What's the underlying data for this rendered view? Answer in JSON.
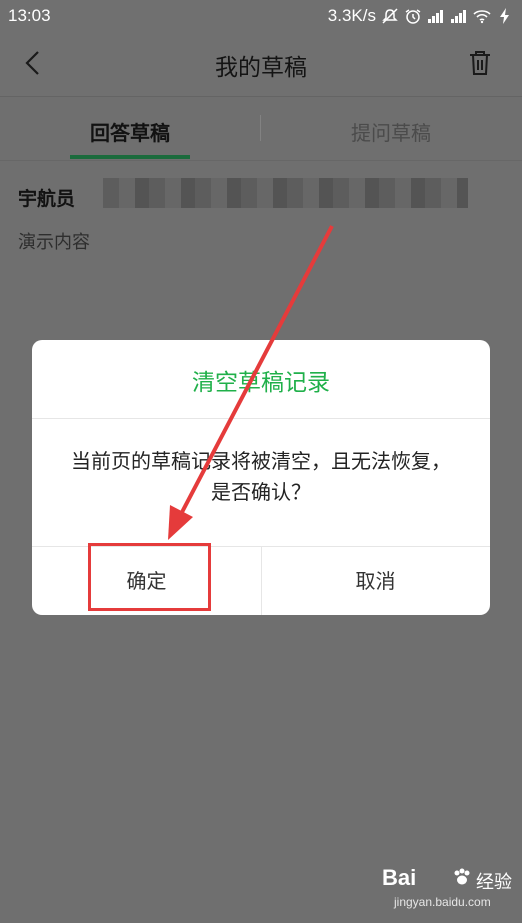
{
  "status_bar": {
    "time": "13:03",
    "network_speed": "3.3K/s",
    "icons": [
      "mute-icon",
      "alarm-icon",
      "signal-icon",
      "signal-icon",
      "wifi-icon",
      "charging-icon"
    ]
  },
  "nav": {
    "title": "我的草稿",
    "back_icon": "back-icon",
    "trash_icon": "trash-icon"
  },
  "tabs": [
    {
      "label": "回答草稿",
      "active": true
    },
    {
      "label": "提问草稿",
      "active": false
    }
  ],
  "draft": {
    "title": "宇航员",
    "subtitle": "演示内容"
  },
  "dialog": {
    "title": "清空草稿记录",
    "message": "当前页的草稿记录将被清空，且无法恢复，是否确认？",
    "confirm_label": "确定",
    "cancel_label": "取消"
  },
  "colors": {
    "accent": "#20b04a",
    "highlight": "#e53b3b",
    "overlay": "#6f6f6f"
  },
  "watermark": {
    "logo": "Bai",
    "brand": "经验",
    "url": "jingyan.baidu.com"
  }
}
